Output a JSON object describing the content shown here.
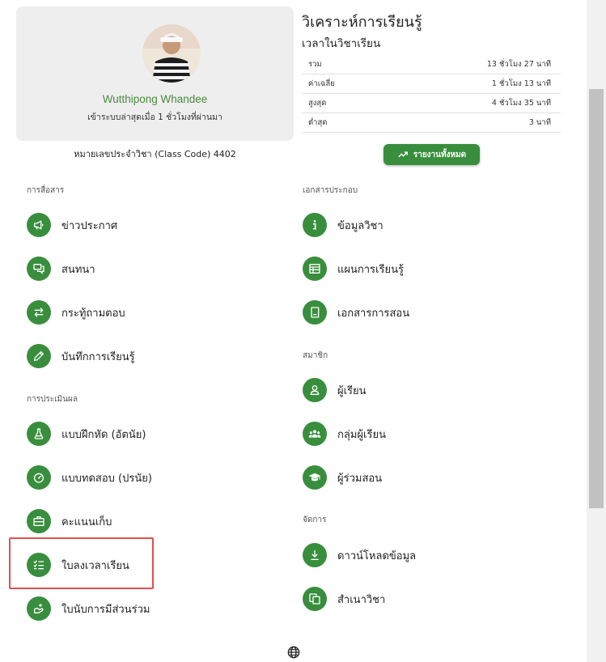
{
  "profile": {
    "name": "Wutthipong Whandee",
    "last_login": "เข้าระบบล่าสุดเมื่อ 1 ชั่วโมงที่ผ่านมา",
    "class_code": "หมายเลขประจำวิชา (Class Code) 4402"
  },
  "analysis": {
    "title": "วิเคราะห์การเรียนรู้",
    "subtitle": "เวลาในวิชาเรียน",
    "rows": [
      {
        "label": "รวม",
        "value": "13 ชั่วโมง 27 นาที"
      },
      {
        "label": "ค่าเฉลี่ย",
        "value": "1 ชั่วโมง 13 นาที"
      },
      {
        "label": "สูงสุด",
        "value": "4 ชั่วโมง 35 นาที"
      },
      {
        "label": "ต่ำสุด",
        "value": "3 นาที"
      }
    ],
    "report_button": "รายงานทั้งหมด"
  },
  "sections": {
    "communication": "การสื่อสาร",
    "assessment": "การประเมินผล",
    "documents": "เอกสารประกอบ",
    "members": "สมาชิก",
    "management": "จัดการ"
  },
  "menu": {
    "announcements": "ข่าวประกาศ",
    "chat": "สนทนา",
    "qa": "กระทู้ถามตอบ",
    "journal": "บันทึกการเรียนรู้",
    "exercise": "แบบฝึกหัด (อัตนัย)",
    "quiz": "แบบทดสอบ (ปรนัย)",
    "scores": "คะแนนเก็บ",
    "attendance": "ใบลงเวลาเรียน",
    "participation": "ใบนับการมีส่วนร่วม",
    "course_info": "ข้อมูลวิชา",
    "lesson_plan": "แผนการเรียนรู้",
    "teaching_docs": "เอกสารการสอน",
    "students": "ผู้เรียน",
    "student_groups": "กลุ่มผู้เรียน",
    "co_teachers": "ผู้ร่วมสอน",
    "download": "ดาวน์โหลดข้อมูล",
    "copy_course": "สำเนาวิชา"
  },
  "colors": {
    "accent": "#388e3c",
    "name_green": "#4a8a3f",
    "highlight": "#e05050"
  },
  "icons": {
    "announcements": "megaphone-icon",
    "chat": "chat-bubbles-icon",
    "qa": "swap-arrows-icon",
    "journal": "pencil-icon",
    "exercise": "flask-icon",
    "quiz": "speedometer-icon",
    "scores": "briefcase-icon",
    "attendance": "checklist-icon",
    "participation": "hand-plus-icon",
    "course_info": "info-icon",
    "lesson_plan": "table-icon",
    "teaching_docs": "book-icon",
    "students": "person-icon",
    "student_groups": "group-icon",
    "co_teachers": "graduation-cap-icon",
    "download": "download-icon",
    "copy_course": "copy-icon",
    "language": "globe-icon"
  }
}
